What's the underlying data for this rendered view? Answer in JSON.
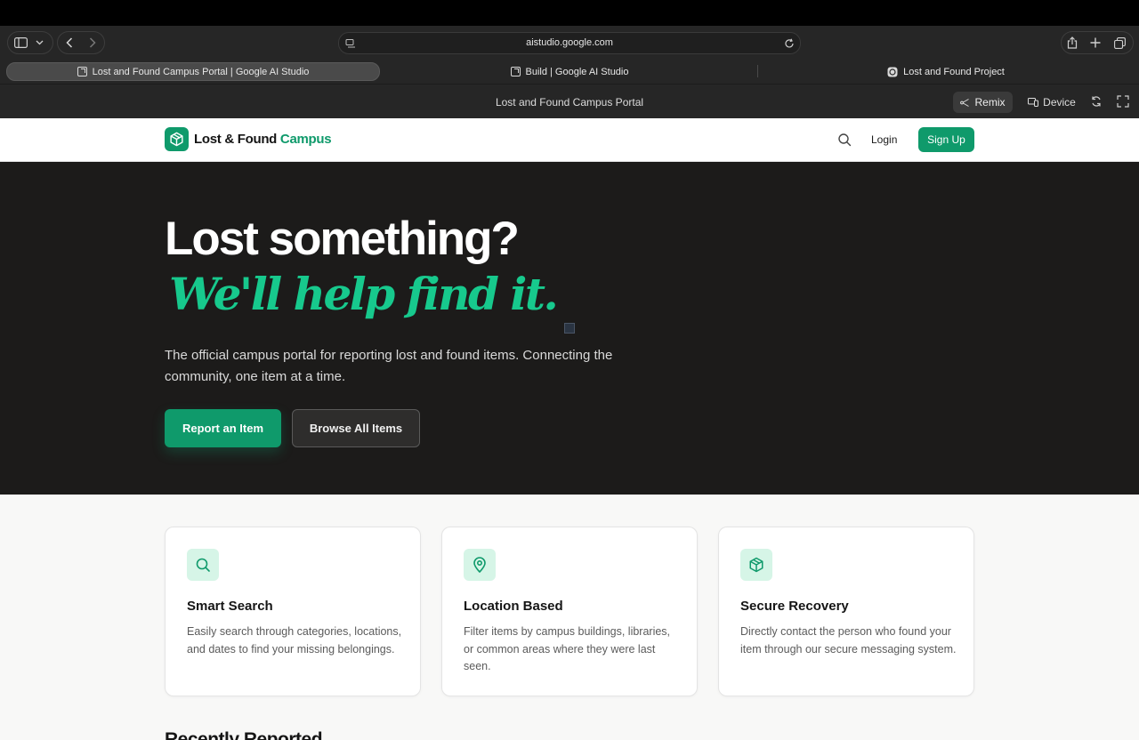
{
  "browser": {
    "url": "aistudio.google.com",
    "tabs": [
      {
        "label": "Lost and Found Campus Portal | Google AI Studio",
        "active": true
      },
      {
        "label": "Build | Google AI Studio",
        "active": false
      },
      {
        "label": "Lost and Found Project",
        "active": false
      }
    ]
  },
  "studio": {
    "title": "Lost and Found Campus Portal",
    "remix_label": "Remix",
    "device_label": "Device"
  },
  "nav": {
    "logo_main": "Lost & Found",
    "logo_accent": "Campus",
    "login_label": "Login",
    "signup_label": "Sign Up"
  },
  "hero": {
    "headline": "Lost something?",
    "subheadline": "We'll help find it.",
    "description": "The official campus portal for reporting lost and found items. Connecting the community, one item at a time.",
    "primary_button": "Report an Item",
    "secondary_button": "Browse All Items"
  },
  "features": [
    {
      "icon": "search-icon",
      "title": "Smart Search",
      "description": "Easily search through categories, locations, and dates to find your missing belongings."
    },
    {
      "icon": "map-pin-icon",
      "title": "Location Based",
      "description": "Filter items by campus buildings, libraries, or common areas where they were last seen."
    },
    {
      "icon": "package-icon",
      "title": "Secure Recovery",
      "description": "Directly contact the person who found your item through our secure messaging system."
    }
  ],
  "recent_heading": "Recently Reported",
  "colors": {
    "brand": "#0f9a6b",
    "accent_text": "#17c98d",
    "hero_bg": "#1c1b1a",
    "feature_icon_bg": "#d6f5e7"
  }
}
